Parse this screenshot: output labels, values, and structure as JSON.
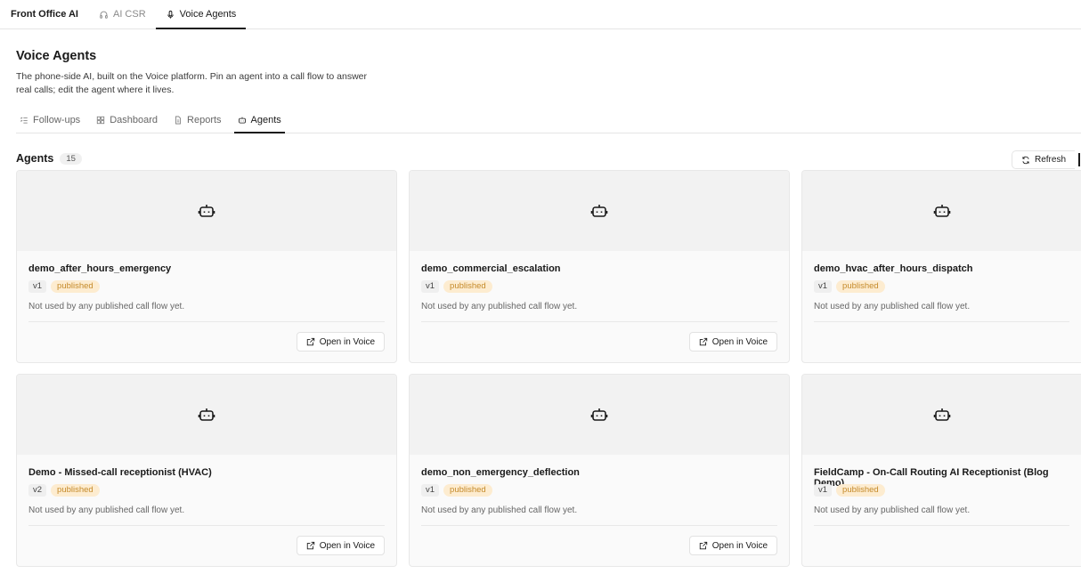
{
  "topbar": {
    "brand": "Front Office AI",
    "tabs": [
      {
        "label": "AI CSR",
        "icon": "headphones-icon",
        "active": false
      },
      {
        "label": "Voice Agents",
        "icon": "microphone-icon",
        "active": true
      }
    ]
  },
  "page": {
    "title": "Voice Agents",
    "description": "The phone-side AI, built on the Voice platform. Pin an agent into a call flow to answer real calls; edit the agent where it lives."
  },
  "subtabs": [
    {
      "label": "Follow-ups",
      "icon": "list-check-icon",
      "active": false
    },
    {
      "label": "Dashboard",
      "icon": "grid-icon",
      "active": false
    },
    {
      "label": "Reports",
      "icon": "document-icon",
      "active": false
    },
    {
      "label": "Agents",
      "icon": "robot-icon",
      "active": true
    }
  ],
  "agents": {
    "label": "Agents",
    "count": "15",
    "refresh_label": "Refresh",
    "open_label": "Open in Voice",
    "items": [
      {
        "name": "demo_after_hours_emergency",
        "version": "v1",
        "status": "published",
        "note": "Not used by any published call flow yet."
      },
      {
        "name": "demo_commercial_escalation",
        "version": "v1",
        "status": "published",
        "note": "Not used by any published call flow yet."
      },
      {
        "name": "demo_hvac_after_hours_dispatch",
        "version": "v1",
        "status": "published",
        "note": "Not used by any published call flow yet."
      },
      {
        "name": "Demo - Missed-call receptionist (HVAC)",
        "version": "v2",
        "status": "published",
        "note": "Not used by any published call flow yet."
      },
      {
        "name": "demo_non_emergency_deflection",
        "version": "v1",
        "status": "published",
        "note": "Not used by any published call flow yet."
      },
      {
        "name": "FieldCamp - On-Call Routing AI Receptionist (Blog Demo)",
        "version": "v1",
        "status": "published",
        "note": "Not used by any published call flow yet."
      }
    ]
  },
  "colors": {
    "published_bg": "#fdecd0",
    "published_text": "#c58a2a",
    "active_underline": "#1a1a1a"
  }
}
